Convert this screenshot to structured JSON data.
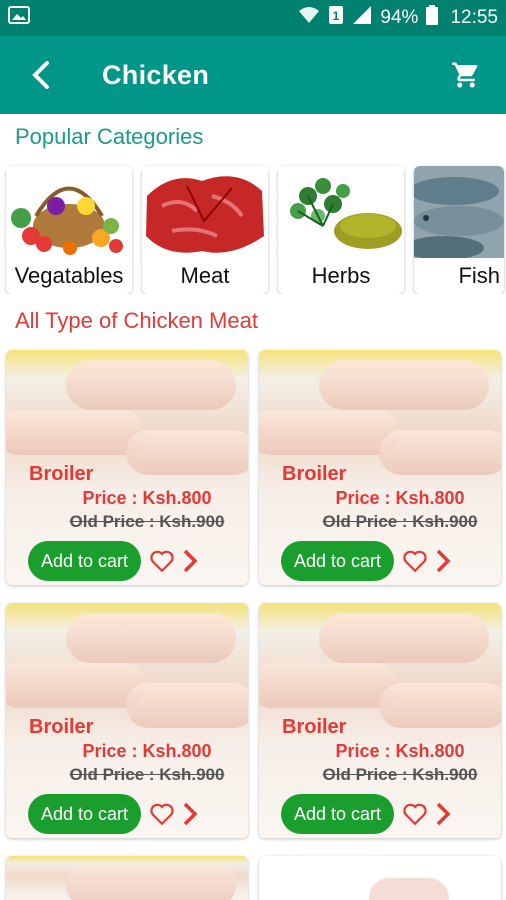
{
  "status": {
    "battery": "94%",
    "time": "12:55",
    "sim": "1"
  },
  "header": {
    "title": "Chicken"
  },
  "sections": {
    "popular": "Popular Categories",
    "alltype": "All Type of Chicken Meat"
  },
  "categories": [
    {
      "label": "Vegatables"
    },
    {
      "label": "Meat"
    },
    {
      "label": "Herbs"
    },
    {
      "label": "Fish"
    }
  ],
  "products": [
    {
      "name": "Broiler",
      "price": "Price : Ksh.800",
      "old_price": "Old Price : Ksh.900",
      "button": "Add to cart"
    },
    {
      "name": "Broiler",
      "price": "Price : Ksh.800",
      "old_price": "Old Price : Ksh.900",
      "button": "Add to cart"
    },
    {
      "name": "Broiler",
      "price": "Price : Ksh.800",
      "old_price": "Old Price : Ksh.900",
      "button": "Add to cart"
    },
    {
      "name": "Broiler",
      "price": "Price : Ksh.800",
      "old_price": "Old Price : Ksh.900",
      "button": "Add to cart"
    }
  ],
  "colors": {
    "statusbar": "#00806f",
    "appbar": "#009688",
    "accent_red": "#e53935",
    "button_green": "#1a9e2e"
  }
}
